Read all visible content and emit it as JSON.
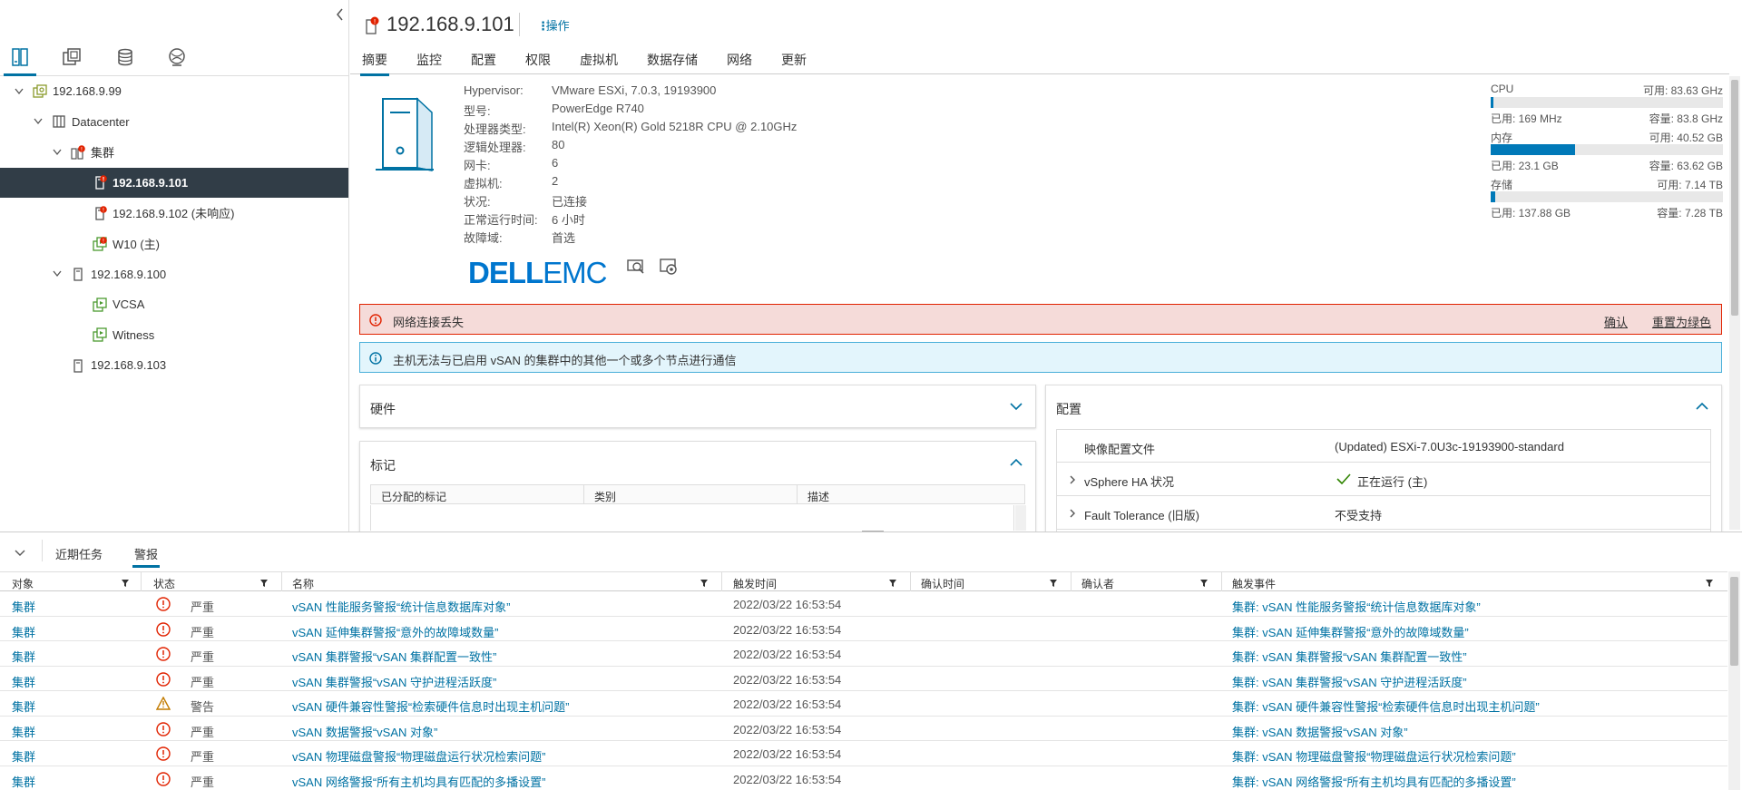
{
  "navigator": {
    "tree": [
      {
        "label": "192.168.9.99",
        "icon": "vcenter-icon",
        "level": 0,
        "expanded": true,
        "alert": false
      },
      {
        "label": "Datacenter",
        "icon": "datacenter-icon",
        "level": 1,
        "expanded": true,
        "alert": false
      },
      {
        "label": "集群",
        "icon": "cluster-icon",
        "level": 2,
        "expanded": true,
        "alert": true
      },
      {
        "label": "192.168.9.101",
        "icon": "host-icon",
        "level": 3,
        "selected": true,
        "alert": true
      },
      {
        "label": "192.168.9.102 (未响应)",
        "icon": "host-icon",
        "level": 3,
        "alert": true
      },
      {
        "label": "W10 (主)",
        "icon": "vm-icon",
        "level": 3,
        "alert": true
      },
      {
        "label": "192.168.9.100",
        "icon": "host-icon",
        "level": 2,
        "expanded": true,
        "alert": false
      },
      {
        "label": "VCSA",
        "icon": "vm-icon",
        "level": 3,
        "alert": false
      },
      {
        "label": "Witness",
        "icon": "vm-icon",
        "level": 3,
        "alert": false
      },
      {
        "label": "192.168.9.103",
        "icon": "host-icon",
        "level": 2,
        "alert": false
      }
    ]
  },
  "header": {
    "title": "192.168.9.101",
    "actions_label": "操作"
  },
  "tabs": [
    "摘要",
    "监控",
    "配置",
    "权限",
    "虚拟机",
    "数据存储",
    "网络",
    "更新"
  ],
  "summary": {
    "rows": [
      {
        "label": "Hypervisor:",
        "value": "VMware ESXi, 7.0.3, 19193900"
      },
      {
        "label": "型号:",
        "value": "PowerEdge R740"
      },
      {
        "label": "处理器类型:",
        "value": "Intel(R) Xeon(R) Gold 5218R CPU @ 2.10GHz"
      },
      {
        "label": "逻辑处理器:",
        "value": "80"
      },
      {
        "label": "网卡:",
        "value": "6"
      },
      {
        "label": "虚拟机:",
        "value": "2"
      },
      {
        "label": "状况:",
        "value": "已连接"
      },
      {
        "label": "正常运行时间:",
        "value": "6 小时"
      },
      {
        "label": "故障域:",
        "value": "首选"
      }
    ],
    "vendor_logo": "DELLEMC"
  },
  "resources": {
    "cpu": {
      "label": "CPU",
      "free": "可用: 83.63 GHz",
      "used": "已用: 169 MHz",
      "capacity": "容量: 83.8 GHz",
      "usage_fraction": 0.002
    },
    "memory": {
      "label": "内存",
      "free": "可用: 40.52 GB",
      "used": "已用: 23.1 GB",
      "capacity": "容量: 63.62 GB",
      "usage_fraction": 0.363
    },
    "storage": {
      "label": "存储",
      "free": "可用: 7.14 TB",
      "used": "已用: 137.88 GB",
      "capacity": "容量: 7.28 TB",
      "usage_fraction": 0.018
    }
  },
  "alerts": {
    "error": {
      "text": "网络连接丢失",
      "ack_label": "确认",
      "reset_label": "重置为绿色"
    },
    "info": {
      "text": "主机无法与已启用 vSAN 的集群中的其他一个或多个节点进行通信"
    }
  },
  "cards": {
    "hardware": {
      "title": "硬件"
    },
    "tags": {
      "title": "标记",
      "columns": [
        "已分配的标记",
        "类别",
        "描述"
      ]
    },
    "config": {
      "title": "配置",
      "rows": [
        {
          "label": "映像配置文件",
          "value": "(Updated) ESXi-7.0U3c-19193900-standard",
          "expandable": false
        },
        {
          "label": "vSphere HA 状况",
          "value": "正在运行 (主)",
          "expandable": true,
          "status_ok": true
        },
        {
          "label": "Fault Tolerance (旧版)",
          "value": "不受支持",
          "expandable": true
        }
      ]
    }
  },
  "bottom": {
    "tabs": [
      "近期任务",
      "警报"
    ],
    "active_tab": 1,
    "columns": [
      "对象",
      "状态",
      "名称",
      "触发时间",
      "确认时间",
      "确认者",
      "触发事件"
    ],
    "rows": [
      {
        "object": "集群",
        "severity": "严重",
        "level": "critical",
        "name": "vSAN 性能服务警报“统计信息数据库对象”",
        "time": "2022/03/22 16:53:54",
        "ack_time": "",
        "ack_by": "",
        "event": "集群: vSAN 性能服务警报“统计信息数据库对象”"
      },
      {
        "object": "集群",
        "severity": "严重",
        "level": "critical",
        "name": "vSAN 延伸集群警报“意外的故障域数量”",
        "time": "2022/03/22 16:53:54",
        "ack_time": "",
        "ack_by": "",
        "event": "集群: vSAN 延伸集群警报“意外的故障域数量”"
      },
      {
        "object": "集群",
        "severity": "严重",
        "level": "critical",
        "name": "vSAN 集群警报“vSAN 集群配置一致性”",
        "time": "2022/03/22 16:53:54",
        "ack_time": "",
        "ack_by": "",
        "event": "集群: vSAN 集群警报“vSAN 集群配置一致性”"
      },
      {
        "object": "集群",
        "severity": "严重",
        "level": "critical",
        "name": "vSAN 集群警报“vSAN 守护进程活跃度”",
        "time": "2022/03/22 16:53:54",
        "ack_time": "",
        "ack_by": "",
        "event": "集群: vSAN 集群警报“vSAN 守护进程活跃度”"
      },
      {
        "object": "集群",
        "severity": "警告",
        "level": "warning",
        "name": "vSAN 硬件兼容性警报“检索硬件信息时出现主机问题”",
        "time": "2022/03/22 16:53:54",
        "ack_time": "",
        "ack_by": "",
        "event": "集群: vSAN 硬件兼容性警报“检索硬件信息时出现主机问题”"
      },
      {
        "object": "集群",
        "severity": "严重",
        "level": "critical",
        "name": "vSAN 数据警报“vSAN 对象”",
        "time": "2022/03/22 16:53:54",
        "ack_time": "",
        "ack_by": "",
        "event": "集群: vSAN 数据警报“vSAN 对象”"
      },
      {
        "object": "集群",
        "severity": "严重",
        "level": "critical",
        "name": "vSAN 物理磁盘警报“物理磁盘运行状况检索问题”",
        "time": "2022/03/22 16:53:54",
        "ack_time": "",
        "ack_by": "",
        "event": "集群: vSAN 物理磁盘警报“物理磁盘运行状况检索问题”"
      },
      {
        "object": "集群",
        "severity": "严重",
        "level": "critical",
        "name": "vSAN 网络警报“所有主机均具有匹配的多播设置”",
        "time": "2022/03/22 16:53:54",
        "ack_time": "",
        "ack_by": "",
        "event": "集群: vSAN 网络警报“所有主机均具有匹配的多播设置”"
      }
    ]
  },
  "colors": {
    "accent": "#0072a3",
    "selected_row": "#313d47",
    "critical": "#e12200",
    "warning": "#c27b00",
    "ok": "#2f8400",
    "bar_fill": "#0079b8"
  }
}
